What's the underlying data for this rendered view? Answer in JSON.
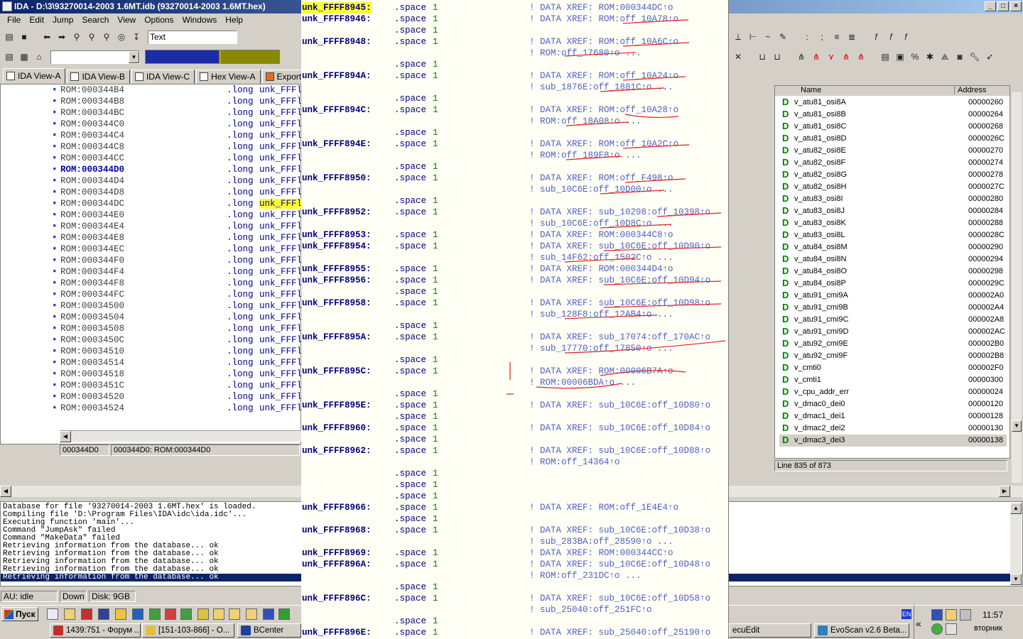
{
  "window": {
    "title": "IDA - D:\\3\\93270014-2003 1.6MT.idb (93270014-2003 1.6MT.hex)",
    "buttons": [
      "_",
      "□",
      "×"
    ]
  },
  "menu": [
    "File",
    "Edit",
    "Jump",
    "Search",
    "View",
    "Options",
    "Windows",
    "Help"
  ],
  "toolbar": {
    "search_mode": "Text",
    "address_combo": ""
  },
  "tabs": [
    {
      "label": "IDA View-A",
      "active": true
    },
    {
      "label": "IDA View-B",
      "active": false
    },
    {
      "label": "IDA View-C",
      "active": false
    },
    {
      "label": "Hex View-A",
      "active": false
    },
    {
      "label": "Exports",
      "active": false
    }
  ],
  "disasm": {
    "rows": [
      {
        "addr": "ROM:000344B4",
        "ins": ".long",
        "op": "unk_FFFl"
      },
      {
        "addr": "ROM:000344B8",
        "ins": ".long",
        "op": "unk_FFFl"
      },
      {
        "addr": "ROM:000344BC",
        "ins": ".long",
        "op": "unk_FFFl"
      },
      {
        "addr": "ROM:000344C0",
        "ins": ".long",
        "op": "unk_FFFl"
      },
      {
        "addr": "ROM:000344C4",
        "ins": ".long",
        "op": "unk_FFFl"
      },
      {
        "addr": "ROM:000344C8",
        "ins": ".long",
        "op": "unk_FFFl"
      },
      {
        "addr": "ROM:000344CC",
        "ins": ".long",
        "op": "unk_FFFl"
      },
      {
        "addr": "ROM:000344D0",
        "ins": ".long",
        "op": "unk_FFFl"
      },
      {
        "addr": "ROM:000344D4",
        "ins": ".long",
        "op": "unk_FFFl"
      },
      {
        "addr": "ROM:000344D8",
        "ins": ".long",
        "op": "unk_FFFl"
      },
      {
        "addr": "ROM:000344DC",
        "ins": ".long",
        "op": "unk_FFFl"
      },
      {
        "addr": "ROM:000344E0",
        "ins": ".long",
        "op": "unk_FFFl"
      },
      {
        "addr": "ROM:000344E4",
        "ins": ".long",
        "op": "unk_FFFl"
      },
      {
        "addr": "ROM:000344E8",
        "ins": ".long",
        "op": "unk_FFFl"
      },
      {
        "addr": "ROM:000344EC",
        "ins": ".long",
        "op": "unk_FFFl"
      },
      {
        "addr": "ROM:000344F0",
        "ins": ".long",
        "op": "unk_FFFl"
      },
      {
        "addr": "ROM:000344F4",
        "ins": ".long",
        "op": "unk_FFFl"
      },
      {
        "addr": "ROM:000344F8",
        "ins": ".long",
        "op": "unk_FFFl"
      },
      {
        "addr": "ROM:000344FC",
        "ins": ".long",
        "op": "unk_FFFl"
      },
      {
        "addr": "ROM:00034500",
        "ins": ".long",
        "op": "unk_FFFl"
      },
      {
        "addr": "ROM:00034504",
        "ins": ".long",
        "op": "unk_FFFl"
      },
      {
        "addr": "ROM:00034508",
        "ins": ".long",
        "op": "unk_FFFl"
      },
      {
        "addr": "ROM:0003450C",
        "ins": ".long",
        "op": "unk_FFFl"
      },
      {
        "addr": "ROM:00034510",
        "ins": ".long",
        "op": "unk_FFFl"
      },
      {
        "addr": "ROM:00034514",
        "ins": ".long",
        "op": "unk_FFFl"
      },
      {
        "addr": "ROM:00034518",
        "ins": ".long",
        "op": "unk_FFFl"
      },
      {
        "addr": "ROM:0003451C",
        "ins": ".long",
        "op": "unk_FFFl"
      },
      {
        "addr": "ROM:00034520",
        "ins": ".long",
        "op": "unk_FFFl"
      },
      {
        "addr": "ROM:00034524",
        "ins": ".long",
        "op": "unk_FFFl"
      }
    ],
    "highlight_addr_index": 7,
    "highlight_op_index": 10,
    "status_addr": "000344D0",
    "status_loc": "000344D0: ROM:000344D0"
  },
  "names": {
    "header_name": "Name",
    "header_address": "Address",
    "rows": [
      {
        "name": "v_atu81_osi8A",
        "addr": "00000260"
      },
      {
        "name": "v_atu81_osi8B",
        "addr": "00000264"
      },
      {
        "name": "v_atu81_osi8C",
        "addr": "00000268"
      },
      {
        "name": "v_atu81_osi8D",
        "addr": "0000026C"
      },
      {
        "name": "v_atu82_osi8E",
        "addr": "00000270"
      },
      {
        "name": "v_atu82_osi8F",
        "addr": "00000274"
      },
      {
        "name": "v_atu82_osi8G",
        "addr": "00000278"
      },
      {
        "name": "v_atu82_osi8H",
        "addr": "0000027C"
      },
      {
        "name": "v_atu83_osi8I",
        "addr": "00000280"
      },
      {
        "name": "v_atu83_osi8J",
        "addr": "00000284"
      },
      {
        "name": "v_atu83_osi8K",
        "addr": "00000288"
      },
      {
        "name": "v_atu83_osi8L",
        "addr": "0000028C"
      },
      {
        "name": "v_atu84_osi8M",
        "addr": "00000290"
      },
      {
        "name": "v_atu84_osi8N",
        "addr": "00000294"
      },
      {
        "name": "v_atu84_osi8O",
        "addr": "00000298"
      },
      {
        "name": "v_atu84_osi8P",
        "addr": "0000029C"
      },
      {
        "name": "v_atu91_cmi9A",
        "addr": "000002A0"
      },
      {
        "name": "v_atu91_cmi9B",
        "addr": "000002A4"
      },
      {
        "name": "v_atu91_cmi9C",
        "addr": "000002A8"
      },
      {
        "name": "v_atu91_cmi9D",
        "addr": "000002AC"
      },
      {
        "name": "v_atu92_cmi9E",
        "addr": "000002B0"
      },
      {
        "name": "v_atu92_cmi9F",
        "addr": "000002B8"
      },
      {
        "name": "v_cmti0",
        "addr": "000002F0"
      },
      {
        "name": "v_cmti1",
        "addr": "00000300"
      },
      {
        "name": "v_cpu_addr_err",
        "addr": "00000024"
      },
      {
        "name": "v_dmac0_dei0",
        "addr": "00000120"
      },
      {
        "name": "v_dmac1_dei1",
        "addr": "00000128"
      },
      {
        "name": "v_dmac2_dei2",
        "addr": "00000130"
      },
      {
        "name": "v_dmac3_dei3",
        "addr": "00000138"
      }
    ],
    "line_status": "Line 835 of 873"
  },
  "output": {
    "lines": [
      "Database for file '93270014-2003 1.6MT.hex' is loaded.",
      "Compiling file 'D:\\Program Files\\IDA\\idc\\ida.idc'...",
      "Executing function 'main'...",
      "Command \"JumpAsk\" failed",
      "Command \"MakeData\" failed",
      "Retrieving information from the database... ok",
      "Retrieving information from the database... ok",
      "Retrieving information from the database... ok",
      "Retrieving information from the database... ok",
      "Retrieving information from the database... ok"
    ]
  },
  "statusbar": {
    "au": "AU:  idle",
    "direction": "Down",
    "disk": "Disk: 9GB"
  },
  "taskbar": {
    "start": "Пуск",
    "items": [
      "1439:751 - Форум ...",
      "[151-103-866] - O...",
      "BCenter",
      "ecuEdit",
      "EvoScan v2.6 Beta..."
    ],
    "lang": "EN",
    "clock": "11:57",
    "day": "вторник"
  },
  "popup": {
    "rows": [
      {
        "label": "unk_FFFF8945:",
        "dir": ".space",
        "num": "1",
        "cmt": "! DATA XREF: ROM:000344DC↑o"
      },
      {
        "label": "unk_FFFF8946:",
        "dir": ".space",
        "num": "1",
        "cmt": "! DATA XREF: ROM:off_10A78↑o"
      },
      {
        "label": "",
        "dir": ".space",
        "num": "1",
        "cmt": ""
      },
      {
        "label": "unk_FFFF8948:",
        "dir": ".space",
        "num": "1",
        "cmt": "! DATA XREF: ROM:off_10A6C↑o"
      },
      {
        "label": "",
        "dir": "",
        "num": "",
        "cmt": "! ROM:off_17680↑o ..."
      },
      {
        "label": "",
        "dir": ".space",
        "num": "1",
        "cmt": ""
      },
      {
        "label": "unk_FFFF894A:",
        "dir": ".space",
        "num": "1",
        "cmt": "! DATA XREF: ROM:off_10A24↑o"
      },
      {
        "label": "",
        "dir": "",
        "num": "",
        "cmt": "! sub_1876E:off_1881C↑o ..."
      },
      {
        "label": "",
        "dir": ".space",
        "num": "1",
        "cmt": ""
      },
      {
        "label": "unk_FFFF894C:",
        "dir": ".space",
        "num": "1",
        "cmt": "! DATA XREF: ROM:off_10A28↑o"
      },
      {
        "label": "",
        "dir": "",
        "num": "",
        "cmt": "! ROM:off_18A08↑o ..."
      },
      {
        "label": "",
        "dir": ".space",
        "num": "1",
        "cmt": ""
      },
      {
        "label": "unk_FFFF894E:",
        "dir": ".space",
        "num": "1",
        "cmt": "! DATA XREF: ROM:off_10A2C↑o"
      },
      {
        "label": "",
        "dir": "",
        "num": "",
        "cmt": "! ROM:off_189F8↑o ..."
      },
      {
        "label": "",
        "dir": ".space",
        "num": "1",
        "cmt": ""
      },
      {
        "label": "unk_FFFF8950:",
        "dir": ".space",
        "num": "1",
        "cmt": "! DATA XREF: ROM:off_F498↑o"
      },
      {
        "label": "",
        "dir": "",
        "num": "",
        "cmt": "! sub_10C6E:off_10D00↑o ..."
      },
      {
        "label": "",
        "dir": ".space",
        "num": "1",
        "cmt": ""
      },
      {
        "label": "unk_FFFF8952:",
        "dir": ".space",
        "num": "1",
        "cmt": "! DATA XREF: sub_10298:off_10398↑o"
      },
      {
        "label": "",
        "dir": "",
        "num": "",
        "cmt": "! sub_10C6E:off_10D8C↑o ..."
      },
      {
        "label": "unk_FFFF8953:",
        "dir": ".space",
        "num": "1",
        "cmt": "! DATA XREF: ROM:000344C8↑o"
      },
      {
        "label": "unk_FFFF8954:",
        "dir": ".space",
        "num": "1",
        "cmt": "! DATA XREF: sub_10C6E:off_10D90↑o"
      },
      {
        "label": "",
        "dir": "",
        "num": "",
        "cmt": "! sub_14F62:off_1502C↑o ..."
      },
      {
        "label": "unk_FFFF8955:",
        "dir": ".space",
        "num": "1",
        "cmt": "! DATA XREF: ROM:000344D4↑o"
      },
      {
        "label": "unk_FFFF8956:",
        "dir": ".space",
        "num": "1",
        "cmt": "! DATA XREF: sub_10C6E:off_10D94↑o"
      },
      {
        "label": "",
        "dir": ".space",
        "num": "1",
        "cmt": ""
      },
      {
        "label": "unk_FFFF8958:",
        "dir": ".space",
        "num": "1",
        "cmt": "! DATA XREF: sub_10C6E:off_10D98↑o"
      },
      {
        "label": "",
        "dir": "",
        "num": "",
        "cmt": "! sub_128F8:off_12AB4↑o ..."
      },
      {
        "label": "",
        "dir": ".space",
        "num": "1",
        "cmt": ""
      },
      {
        "label": "unk_FFFF895A:",
        "dir": ".space",
        "num": "1",
        "cmt": "! DATA XREF: sub_17074:off_170AC↑o"
      },
      {
        "label": "",
        "dir": "",
        "num": "",
        "cmt": "! sub_17770:off_17850↑o ..."
      },
      {
        "label": "",
        "dir": ".space",
        "num": "1",
        "cmt": ""
      },
      {
        "label": "unk_FFFF895C:",
        "dir": ".space",
        "num": "1",
        "cmt": "! DATA XREF: ROM:00006B7A↑o"
      },
      {
        "label": "",
        "dir": "",
        "num": "",
        "cmt": "! ROM:00006BDA↑o ..."
      },
      {
        "label": "",
        "dir": ".space",
        "num": "1",
        "cmt": ""
      },
      {
        "label": "unk_FFFF895E:",
        "dir": ".space",
        "num": "1",
        "cmt": "! DATA XREF: sub_10C6E:off_10D80↑o"
      },
      {
        "label": "",
        "dir": ".space",
        "num": "1",
        "cmt": ""
      },
      {
        "label": "unk_FFFF8960:",
        "dir": ".space",
        "num": "1",
        "cmt": "! DATA XREF: sub_10C6E:off_10D84↑o"
      },
      {
        "label": "",
        "dir": ".space",
        "num": "1",
        "cmt": ""
      },
      {
        "label": "unk_FFFF8962:",
        "dir": ".space",
        "num": "1",
        "cmt": "! DATA XREF: sub_10C6E:off_10D88↑o"
      },
      {
        "label": "",
        "dir": "",
        "num": "",
        "cmt": "! ROM:off_14364↑o"
      },
      {
        "label": "",
        "dir": ".space",
        "num": "1",
        "cmt": ""
      },
      {
        "label": "",
        "dir": ".space",
        "num": "1",
        "cmt": ""
      },
      {
        "label": "",
        "dir": ".space",
        "num": "1",
        "cmt": ""
      },
      {
        "label": "unk_FFFF8966:",
        "dir": ".space",
        "num": "1",
        "cmt": "! DATA XREF: ROM:off_1E4E4↑o"
      },
      {
        "label": "",
        "dir": ".space",
        "num": "1",
        "cmt": ""
      },
      {
        "label": "unk_FFFF8968:",
        "dir": ".space",
        "num": "1",
        "cmt": "! DATA XREF: sub_10C6E:off_10D38↑o"
      },
      {
        "label": "",
        "dir": "",
        "num": "",
        "cmt": "! sub_283BA:off_28590↑o ..."
      },
      {
        "label": "unk_FFFF8969:",
        "dir": ".space",
        "num": "1",
        "cmt": "! DATA XREF: ROM:000344CC↑o"
      },
      {
        "label": "unk_FFFF896A:",
        "dir": ".space",
        "num": "1",
        "cmt": "! DATA XREF: sub_10C6E:off_10D48↑o"
      },
      {
        "label": "",
        "dir": "",
        "num": "",
        "cmt": "! ROM:off_231DC↑o ..."
      },
      {
        "label": "",
        "dir": ".space",
        "num": "1",
        "cmt": ""
      },
      {
        "label": "unk_FFFF896C:",
        "dir": ".space",
        "num": "1",
        "cmt": "! DATA XREF: sub_10C6E:off_10D58↑o"
      },
      {
        "label": "",
        "dir": "",
        "num": "",
        "cmt": "! sub_25040:off_251FC↑o"
      },
      {
        "label": "",
        "dir": ".space",
        "num": "1",
        "cmt": ""
      },
      {
        "label": "unk_FFFF896E:",
        "dir": ".space",
        "num": "1",
        "cmt": "! DATA XREF: sub_25040:off_25190↑o"
      }
    ],
    "highlight_label_index": 0
  }
}
